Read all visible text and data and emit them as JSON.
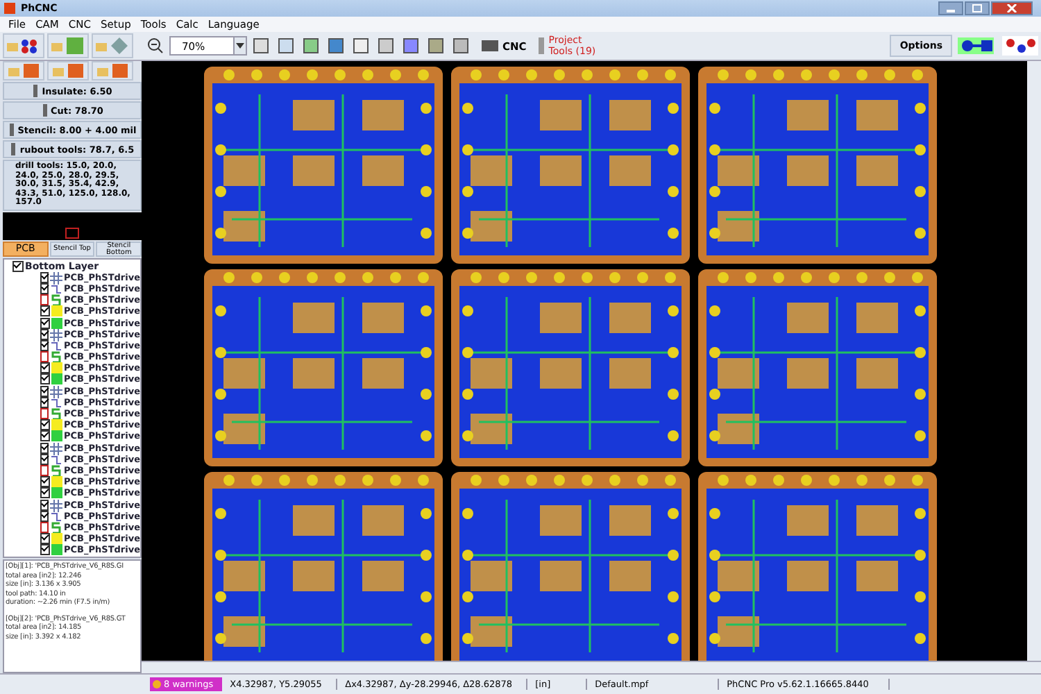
{
  "window": {
    "title": "PhCNC"
  },
  "menu": [
    "File",
    "CAM",
    "CNC",
    "Setup",
    "Tools",
    "Calc",
    "Language"
  ],
  "toolbar": {
    "zoom": "70%",
    "cnc": "CNC",
    "project_tools": "Project\nTools (19)",
    "options": "Options"
  },
  "tools": [
    {
      "label": "Insulate:  6.50"
    },
    {
      "label": "Cut: 78.70"
    },
    {
      "label": "Stencil:  8.00 +  4.00 mil"
    },
    {
      "label": "rubout tools: 78.7, 6.5"
    }
  ],
  "drill_tools": "drill tools: 15.0, 20.0, 24.0, 25.0, 28.0, 29.5, 30.0, 31.5, 35.4, 42.9, 43.3, 51.0, 125.0, 128.0, 157.0",
  "tabs": [
    {
      "label": "PCB",
      "selected": true
    },
    {
      "label": "Stencil Top",
      "selected": false
    },
    {
      "label": "Stencil Bottom",
      "selected": false
    }
  ],
  "tree": {
    "label": "Bottom Layer",
    "checked": true,
    "children": [
      {
        "kind": "grid",
        "checked": true,
        "label": "PCB_PhSTdrive"
      },
      {
        "kind": "route",
        "checked": true,
        "label": "PCB_PhSTdrive"
      },
      {
        "kind": "s",
        "checked": false,
        "label": "PCB_PhSTdrive"
      },
      {
        "kind": "bd",
        "checked": true,
        "label": "PCB_PhSTdrive"
      },
      {
        "kind": "bs",
        "checked": true,
        "label": "PCB_PhSTdrive"
      },
      {
        "kind": "grid",
        "checked": true,
        "label": "PCB_PhSTdrive"
      },
      {
        "kind": "route",
        "checked": true,
        "label": "PCB_PhSTdrive"
      },
      {
        "kind": "s",
        "checked": false,
        "label": "PCB_PhSTdrive"
      },
      {
        "kind": "bd",
        "checked": true,
        "label": "PCB_PhSTdrive"
      },
      {
        "kind": "bs",
        "checked": true,
        "label": "PCB_PhSTdrive"
      },
      {
        "kind": "grid",
        "checked": true,
        "label": "PCB_PhSTdrive"
      },
      {
        "kind": "route",
        "checked": true,
        "label": "PCB_PhSTdrive"
      },
      {
        "kind": "s",
        "checked": false,
        "label": "PCB_PhSTdrive"
      },
      {
        "kind": "bd",
        "checked": true,
        "label": "PCB_PhSTdrive"
      },
      {
        "kind": "bs",
        "checked": true,
        "label": "PCB_PhSTdrive"
      },
      {
        "kind": "grid",
        "checked": true,
        "label": "PCB_PhSTdrive"
      },
      {
        "kind": "route",
        "checked": true,
        "label": "PCB_PhSTdrive"
      },
      {
        "kind": "s",
        "checked": false,
        "label": "PCB_PhSTdrive"
      },
      {
        "kind": "bd",
        "checked": true,
        "label": "PCB_PhSTdrive"
      },
      {
        "kind": "bs",
        "checked": true,
        "label": "PCB_PhSTdrive"
      },
      {
        "kind": "grid",
        "checked": true,
        "label": "PCB_PhSTdrive"
      },
      {
        "kind": "route",
        "checked": true,
        "label": "PCB_PhSTdrive"
      },
      {
        "kind": "s",
        "checked": false,
        "label": "PCB_PhSTdrive"
      },
      {
        "kind": "bd",
        "checked": true,
        "label": "PCB_PhSTdrive"
      },
      {
        "kind": "bs",
        "checked": true,
        "label": "PCB_PhSTdrive"
      }
    ]
  },
  "info": [
    {
      "lines": [
        "[Obj][1]: 'PCB_PhSTdrive_V6_R8S.GI",
        "total area [in2]: 12.246",
        "size [in]: 3.136 x 3.905",
        "tool path: 14.10 in",
        "duration: ~2.26 min (F7.5 in/m)"
      ]
    },
    {
      "lines": [
        "[Obj][2]: 'PCB_PhSTdrive_V6_R8S.GT",
        "total area [in2]: 14.185",
        "size [in]: 3.392 x 4.182"
      ]
    }
  ],
  "status_bar": {
    "warnings": "8 warnings",
    "position": "X4.32987, Y5.29055",
    "delta": "Δx4.32987, Δy-28.29946, Δ28.62878",
    "units": "[in]",
    "file": "Default.mpf",
    "version": "PhCNC Pro v5.62.1.16665.8440"
  }
}
